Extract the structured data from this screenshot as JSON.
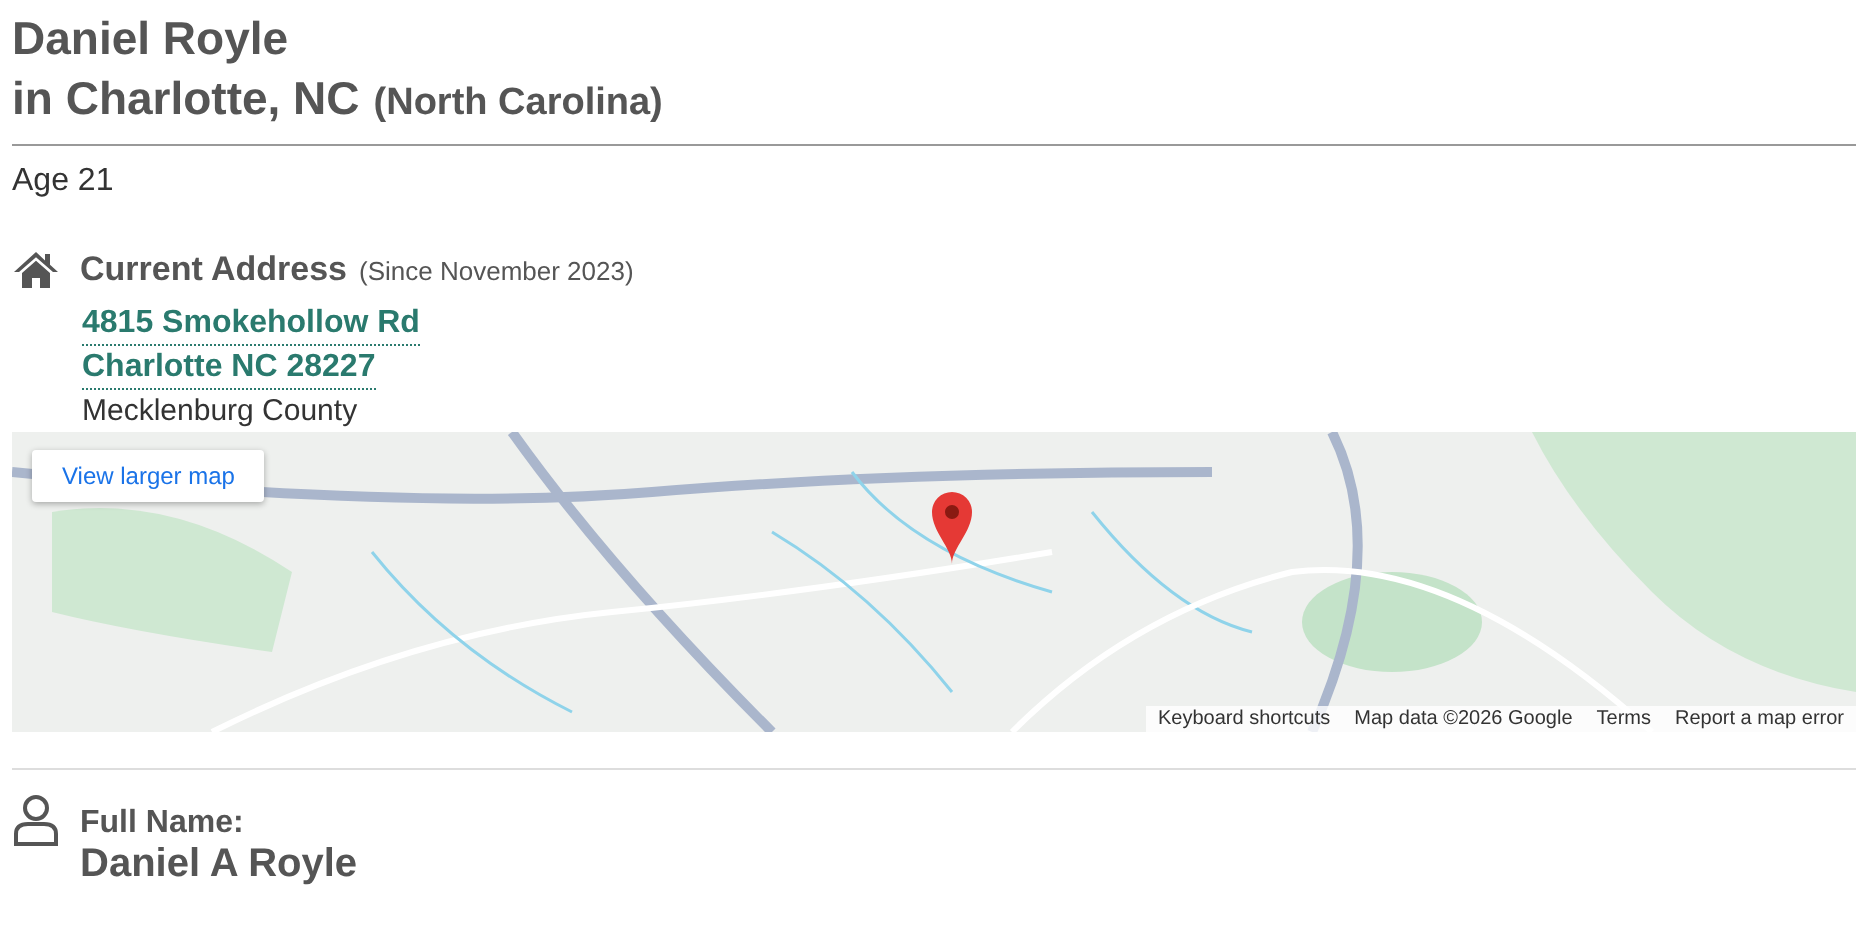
{
  "heading": {
    "name": "Daniel Royle",
    "location": "in Charlotte, NC",
    "state": "(North Carolina)"
  },
  "age": "Age 21",
  "current_address": {
    "label": "Current Address",
    "since": "(Since November 2023)",
    "lines": [
      "4815 Smokehollow Rd",
      "Charlotte NC 28227"
    ],
    "county": "Mecklenburg County",
    "map": {
      "larger_map_link": "View larger map",
      "footer_links": [
        "Keyboard shortcuts",
        "Map data ©2026 Google",
        "Terms",
        "Report a map error"
      ]
    }
  },
  "full_name": {
    "label": "Full Name:",
    "value": "Daniel A Royle"
  }
}
